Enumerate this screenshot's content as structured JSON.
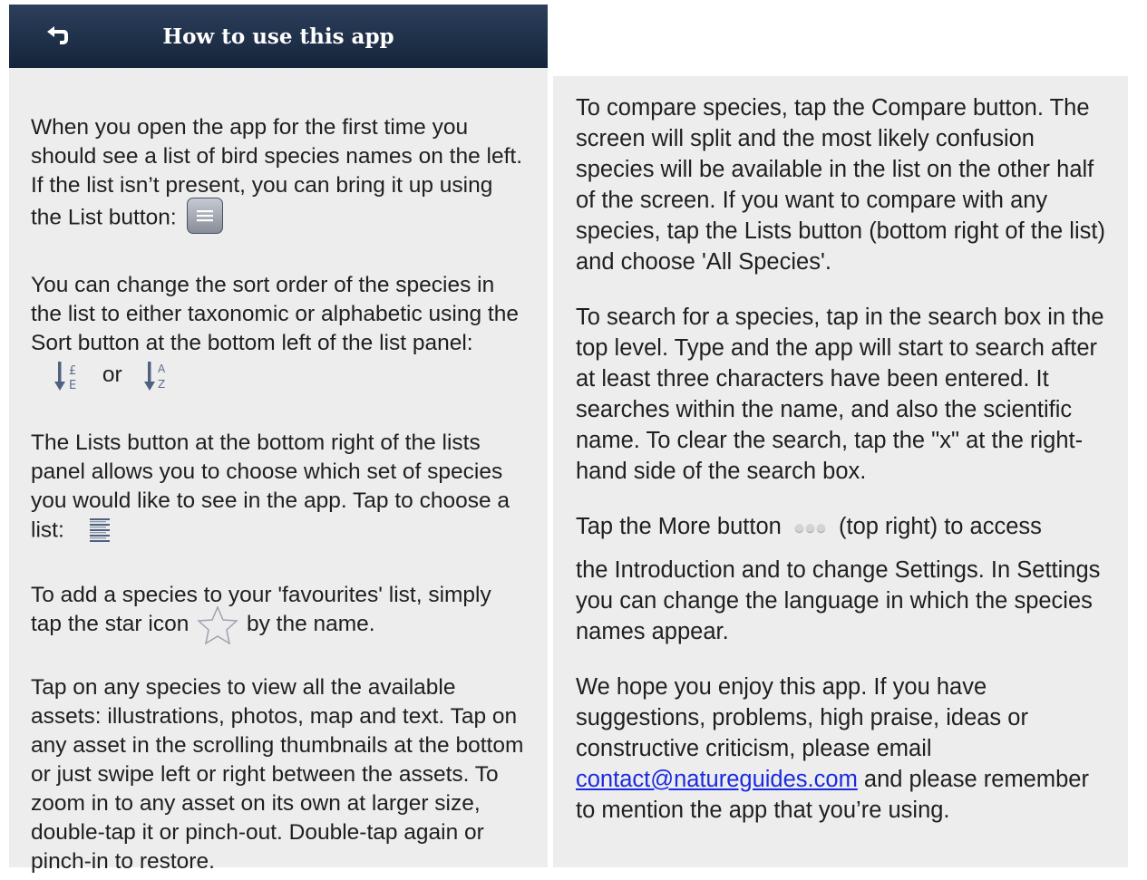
{
  "navbar": {
    "title": "How to use this app",
    "back_icon": "back-arrow-icon"
  },
  "left": {
    "p1_text": "When you open the app for the first time you should see a list of bird species names on the left. If the list isn’t present, you can bring it up using the List button:",
    "p2_text": "You can change the sort order of the species in the list to either taxonomic or alphabetic using the Sort button at the bottom left of the list panel:",
    "p2_or": "or",
    "p3_text": "The Lists button at the bottom right of the lists panel allows you to choose which set of species you would like to see in the app. Tap to choose a list:",
    "p4_before": "To add a species to your 'favourites' list, simply tap the star icon",
    "p4_after": "by the name.",
    "p5_text": "Tap on any species to view all the available assets: illustrations, photos, map and text. Tap on any asset in the scrolling thumbnails at the bottom or just swipe left or right between the assets. To zoom in to any asset on its own at larger size, double-tap it or pinch-out. Double-tap again or pinch-in to restore."
  },
  "right": {
    "p1_text": "To compare species, tap the Compare button. The screen will split and the most likely confusion species will be available in the list on the other half of the screen. If you want to compare with any species, tap the Lists button (bottom right of the list) and choose 'All Species'.",
    "p2_text": "To search for a species, tap in the search box in the top level. Type and the app will start to search after at least three characters have been entered. It searches within the name, and also the scientific name. To clear the search, tap the \"x\" at the right-hand side of the search box.",
    "p3_before": "Tap the More button",
    "p3_after": "(top right) to access",
    "p3_rest": "the Introduction and to change Settings. In Settings you can change the language in which the species names appear.",
    "p4_before": "We hope you enjoy this app. If you have suggestions, problems, high praise, ideas or constructive criticism, please email",
    "p4_link": "contact@natureguides.com",
    "p4_after": "and please remember to mention the app that you’re using."
  },
  "colors": {
    "navbar": "#1c2c45",
    "panel": "#ededee",
    "link": "#1a2ae0"
  }
}
